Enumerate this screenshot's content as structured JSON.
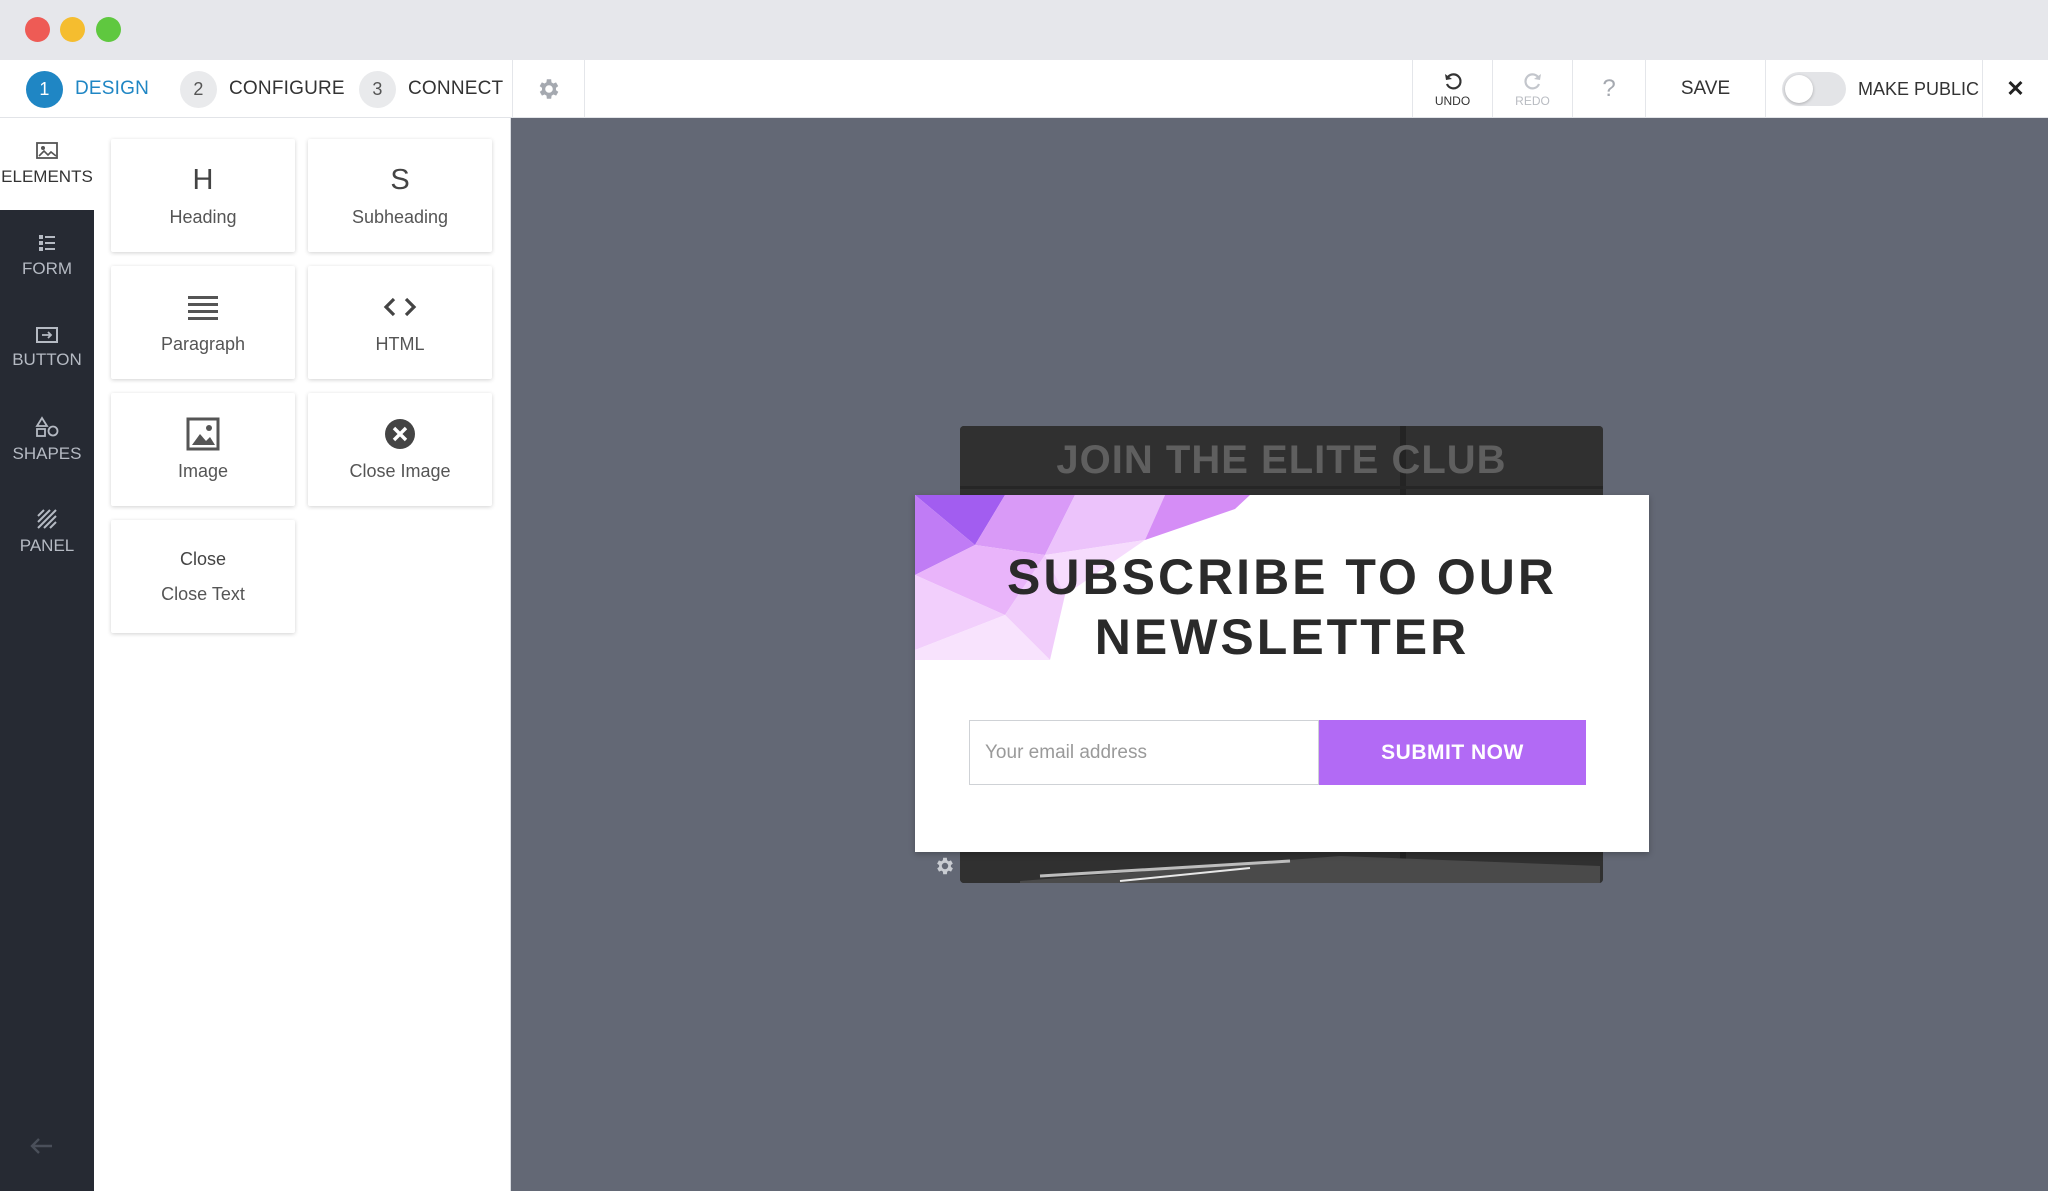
{
  "toolbar": {
    "steps": [
      {
        "num": "1",
        "label": "DESIGN"
      },
      {
        "num": "2",
        "label": "CONFIGURE"
      },
      {
        "num": "3",
        "label": "CONNECT"
      }
    ],
    "undo_label": "UNDO",
    "redo_label": "REDO",
    "help_label": "?",
    "save_label": "SAVE",
    "public_label": "MAKE PUBLIC",
    "public_enabled": false,
    "close_label": "✕"
  },
  "rail": {
    "items": [
      {
        "label": "ELEMENTS",
        "icon": "image-icon"
      },
      {
        "label": "FORM",
        "icon": "list-icon"
      },
      {
        "label": "BUTTON",
        "icon": "button-icon"
      },
      {
        "label": "SHAPES",
        "icon": "shapes-icon"
      },
      {
        "label": "PANEL",
        "icon": "panel-icon"
      }
    ],
    "back_icon": "arrow-left-icon"
  },
  "elements": [
    {
      "glyph": "H",
      "label": "Heading"
    },
    {
      "glyph": "S",
      "label": "Subheading"
    },
    {
      "glyph": "",
      "label": "Paragraph"
    },
    {
      "glyph": "",
      "label": "HTML"
    },
    {
      "glyph": "",
      "label": "Image"
    },
    {
      "glyph": "",
      "label": "Close Image"
    },
    {
      "glyph": "Close",
      "label": "Close Text"
    }
  ],
  "canvas": {
    "background_title": "JOIN THE ELITE CLUB",
    "popup_title_line1": "SUBSCRIBE TO OUR",
    "popup_title_line2": "NEWSLETTER",
    "email_placeholder": "Your email address",
    "submit_label": "SUBMIT NOW"
  },
  "colors": {
    "accent": "#1f86c4",
    "submit": "#b26af5",
    "canvas": "#636875",
    "rail": "#262a33"
  }
}
